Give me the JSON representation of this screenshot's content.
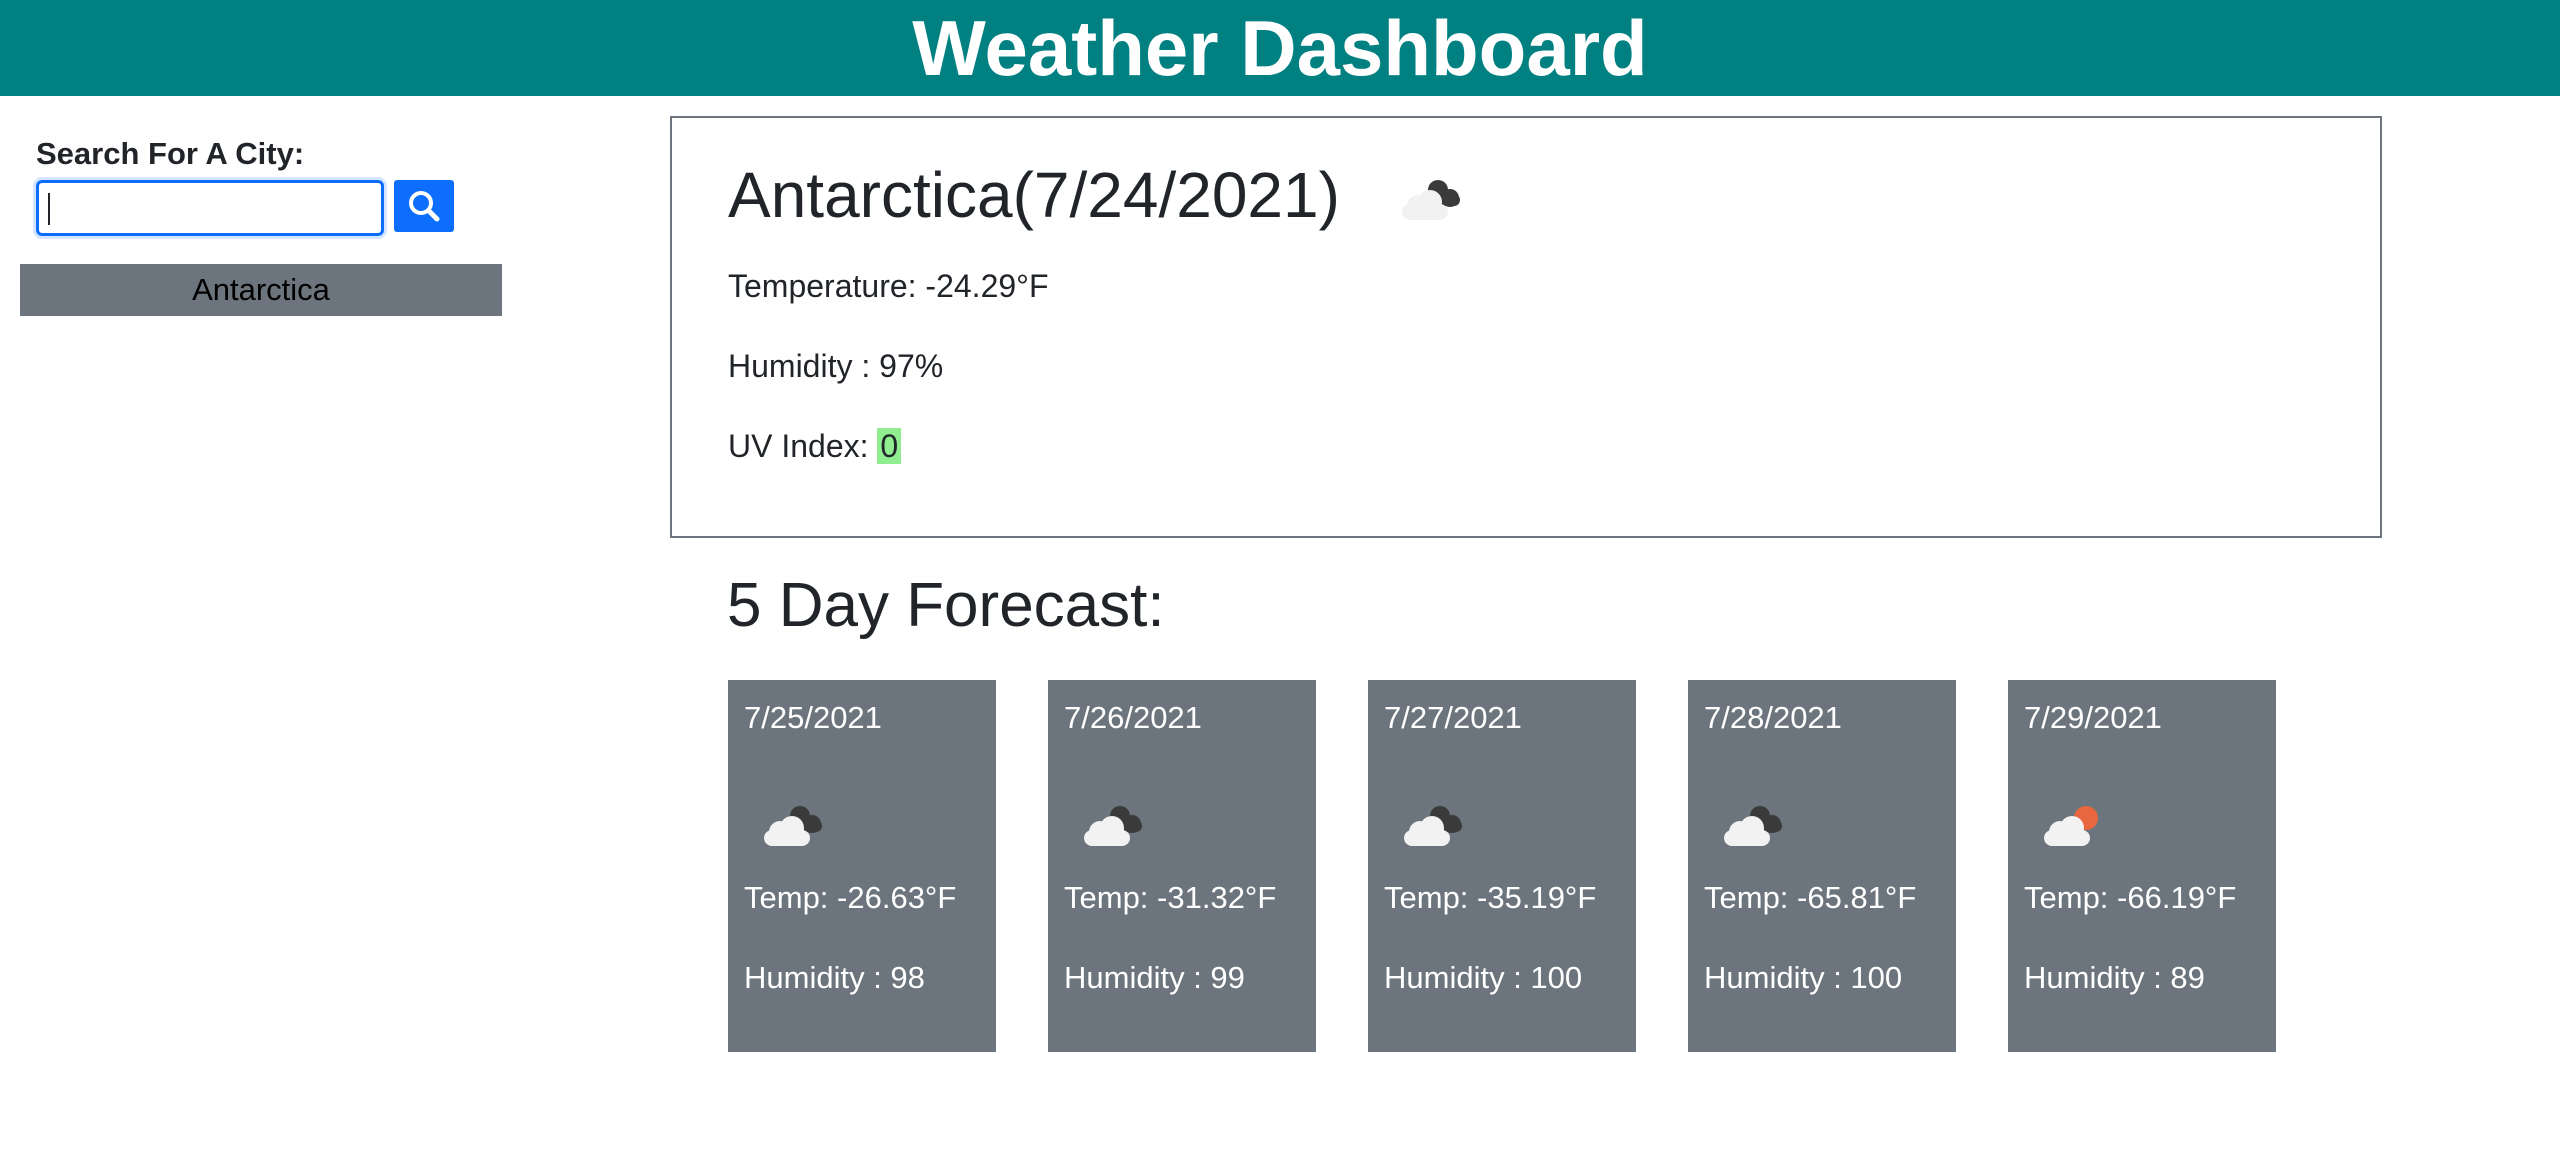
{
  "header": {
    "title": "Weather Dashboard"
  },
  "sidebar": {
    "search_label": "Search For A City:",
    "search_value": "",
    "search_icon": "search-icon",
    "history": [
      {
        "label": "Antarctica"
      }
    ]
  },
  "current": {
    "title": "Antarctica(7/24/2021)",
    "icon": "broken-clouds-night-icon",
    "temperature_label": "Temperature: ",
    "temperature_value": "-24.29°F",
    "humidity_label": "Humidity : ",
    "humidity_value": "97%",
    "uv_label": "UV Index: ",
    "uv_value": "0",
    "uv_color": "#90ee90"
  },
  "forecast": {
    "title": "5 Day Forecast:",
    "days": [
      {
        "date": "7/25/2021",
        "icon": "broken-clouds-night-icon",
        "temp": "Temp: -26.63°F",
        "humidity": "Humidity : 98"
      },
      {
        "date": "7/26/2021",
        "icon": "broken-clouds-night-icon",
        "temp": "Temp: -31.32°F",
        "humidity": "Humidity : 99"
      },
      {
        "date": "7/27/2021",
        "icon": "broken-clouds-night-icon",
        "temp": "Temp: -35.19°F",
        "humidity": "Humidity : 100"
      },
      {
        "date": "7/28/2021",
        "icon": "broken-clouds-night-icon",
        "temp": "Temp: -65.81°F",
        "humidity": "Humidity : 100"
      },
      {
        "date": "7/29/2021",
        "icon": "few-clouds-day-icon",
        "temp": "Temp: -66.19°F",
        "humidity": "Humidity : 89"
      }
    ]
  },
  "colors": {
    "header_bg": "#008080",
    "card_bg": "#6c757d",
    "accent": "#0d6efd"
  }
}
